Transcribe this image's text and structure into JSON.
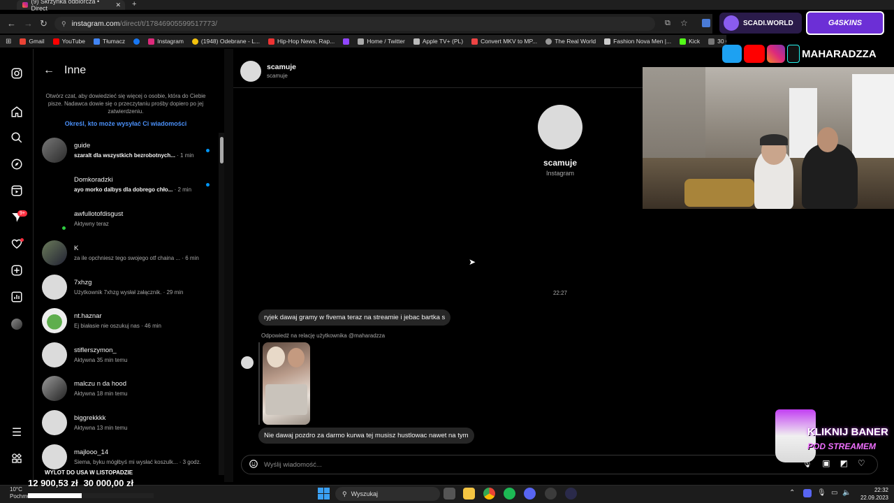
{
  "browser": {
    "tab_title": "(9) Skrzynka odbiorcza • Direct",
    "tab_close": "✕",
    "new_tab": "+",
    "url_domain": "instagram.com",
    "url_path": "/direct/t/17846905599517773/",
    "bookmarks": [
      {
        "label": "Gmail",
        "color": "#ea4335"
      },
      {
        "label": "YouTube",
        "color": "#ff0000"
      },
      {
        "label": "Tłumacz",
        "color": "#4285f4"
      },
      {
        "label": "",
        "color": "#1877f2"
      },
      {
        "label": "Instagram",
        "color": "#dd2a7b"
      },
      {
        "label": "(1948) Odebrane - L...",
        "color": "#f4c20d"
      },
      {
        "label": "Hip-Hop News, Rap...",
        "color": "#e33"
      },
      {
        "label": "",
        "color": "#9146ff"
      },
      {
        "label": "Home / Twitter",
        "color": "#aaa"
      },
      {
        "label": "Apple TV+ (PL)",
        "color": "#bbb"
      },
      {
        "label": "Convert MKV to MP...",
        "color": "#e44"
      },
      {
        "label": "The Real World",
        "color": "#999"
      },
      {
        "label": "Fashion Nova Men |...",
        "color": "#ccc"
      },
      {
        "label": "Kick",
        "color": "#53fc18"
      },
      {
        "label": "30 Greatest Black M...",
        "color": "#777"
      }
    ]
  },
  "nav": {
    "notif_badge": "9+"
  },
  "inbox": {
    "title": "Inne",
    "description": "Otwórz czat, aby dowiedzieć się więcej o osobie, która do Ciebie pisze. Nadawca dowie się o przeczytaniu prośby dopiero po jej zatwierdzeniu.",
    "link": "Określ, kto może wysyłać Ci wiadomości",
    "threads": [
      {
        "name": "guide",
        "preview": "szaralt dla wszystkich bezrobotnych...",
        "time": " · 1 min",
        "unread": true,
        "avatar": "photo",
        "online": false
      },
      {
        "name": "Domkoradzki",
        "preview": "ayo morko dalbys dla dobrego chło...",
        "time": " · 2 min",
        "unread": true,
        "avatar": "dark",
        "online": false
      },
      {
        "name": "awfullotofdisgust",
        "preview": "Aktywny teraz",
        "time": "",
        "unread": false,
        "avatar": "dark",
        "online": true
      },
      {
        "name": "K",
        "preview": "za ile opchniesz tego swojego otf chaina ...",
        "time": " · 6 min",
        "unread": false,
        "avatar": "photo",
        "online": false
      },
      {
        "name": "7xhzg",
        "preview": "Użytkownik 7xhzg wysłał załącznik.",
        "time": " · 29 min",
        "unread": false,
        "avatar": "light",
        "online": false
      },
      {
        "name": "nt.haznar",
        "preview": "Ej białasie nie oszukuj nas",
        "time": " · 46 min",
        "unread": false,
        "avatar": "photo",
        "online": false
      },
      {
        "name": "stiflerszymon_",
        "preview": "Aktywna 35 min temu",
        "time": "",
        "unread": false,
        "avatar": "light",
        "online": false
      },
      {
        "name": "malczu n da hood",
        "preview": "Aktywna 18 min temu",
        "time": "",
        "unread": false,
        "avatar": "photo",
        "online": false
      },
      {
        "name": "biggrekkkk",
        "preview": "Aktywna 13 min temu",
        "time": "",
        "unread": false,
        "avatar": "light",
        "online": false
      },
      {
        "name": "majlooo_14",
        "preview": "Siema, byku mógłbyś mi wysłać koszulk...",
        "time": " · 3 godz.",
        "unread": false,
        "avatar": "light",
        "online": false
      }
    ]
  },
  "chat": {
    "header_name": "scamuje",
    "header_sub": "scamuje",
    "profile_name": "scamuje",
    "profile_sub": "Instagram",
    "timestamp": "22:27",
    "message_1": "ryjek dawaj gramy w fivema teraz na streamie i jebac bartka s",
    "reply_label": "Odpowiedź na relację użytkownika @maharadzza",
    "message_2": "Nie dawaj pozdro za darmo kurwa tej musisz hustlowac nawet na tym",
    "composer_placeholder": "Wyślij wiadomość..."
  },
  "overlay": {
    "brand_1": "SCADI.WORLD",
    "brand_2": "G4SKINS",
    "channel": "MAHARADZZA",
    "banner_line_1": "KLIKNIJ BANER",
    "banner_line_2": "POD STREAMEM",
    "donate_title": "WYLOT DO USA W LISTOPADZIE",
    "donate_current": "12 900,53 zł",
    "donate_goal": "30 000,00 zł",
    "donate_progress": 0.43
  },
  "taskbar": {
    "weather_temp": "10°C",
    "weather_desc": "Pochmurnie",
    "search": "Wyszukaj",
    "time": "22:32",
    "date": "22.09.2023"
  }
}
